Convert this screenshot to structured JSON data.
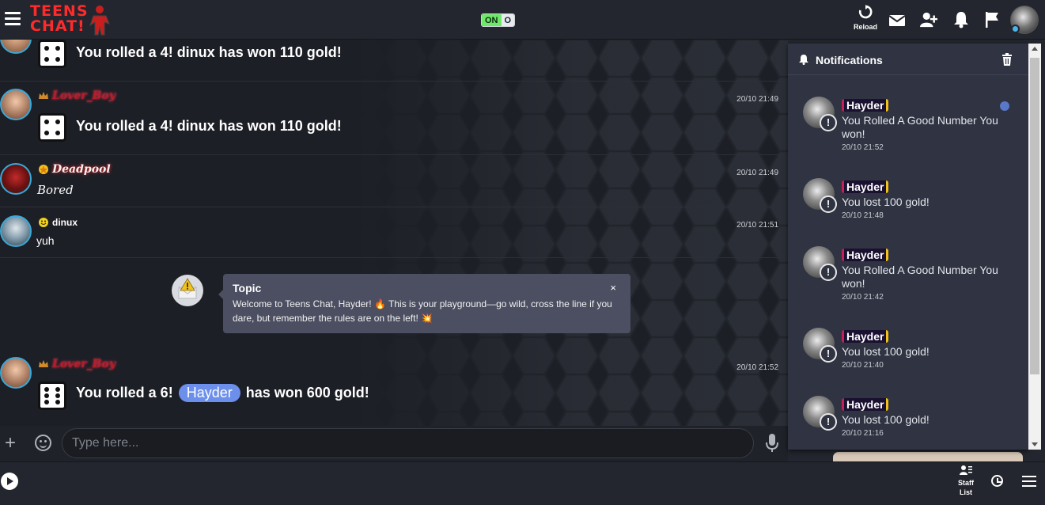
{
  "header": {
    "logo_line1": "TEENS",
    "logo_line2": "CHAT!",
    "toggle_on": "ON",
    "toggle_off": "O",
    "reload_label": "Reload"
  },
  "messages": [
    {
      "type": "roll",
      "text": "You rolled a 4! dinux has won 110 gold!"
    },
    {
      "type": "roll",
      "username": "Lover_Boy",
      "time": "20/10 21:49",
      "text": "You rolled a 4! dinux has won 110 gold!"
    },
    {
      "type": "text",
      "username": "Deadpool",
      "time": "20/10 21:49",
      "text": "Bored"
    },
    {
      "type": "text",
      "username": "dinux",
      "time": "20/10 21:51",
      "text": "yuh"
    },
    {
      "type": "roll",
      "username": "Lover_Boy",
      "time": "20/10 21:52",
      "text_before": "You rolled a 6!",
      "mention": "Hayder",
      "text_after": "has won 600 gold!"
    }
  ],
  "topic": {
    "title": "Topic",
    "text": "Welcome to Teens Chat, Hayder! 🔥 This is your playground—go wild, cross the line if you dare, but remember the rules are on the left! 💥",
    "close": "×"
  },
  "input": {
    "placeholder": "Type here..."
  },
  "notifications": {
    "title": "Notifications",
    "items": [
      {
        "user": "Hayder",
        "text": "You Rolled A Good Number You won!",
        "time": "20/10 21:52",
        "unread": true
      },
      {
        "user": "Hayder",
        "text": "You lost 100 gold!",
        "time": "20/10 21:48",
        "unread": false
      },
      {
        "user": "Hayder",
        "text": "You Rolled A Good Number You won!",
        "time": "20/10 21:42",
        "unread": false
      },
      {
        "user": "Hayder",
        "text": "You lost 100 gold!",
        "time": "20/10 21:40",
        "unread": false
      },
      {
        "user": "Hayder",
        "text": "You lost 100 gold!",
        "time": "20/10 21:16",
        "unread": false
      }
    ]
  },
  "footer": {
    "staff_list": "Staff List"
  },
  "colors": {
    "accent": "#6b8fea",
    "brand": "#ff2b2b",
    "toggle_on": "#6de86a",
    "panel": "#2f3342"
  }
}
